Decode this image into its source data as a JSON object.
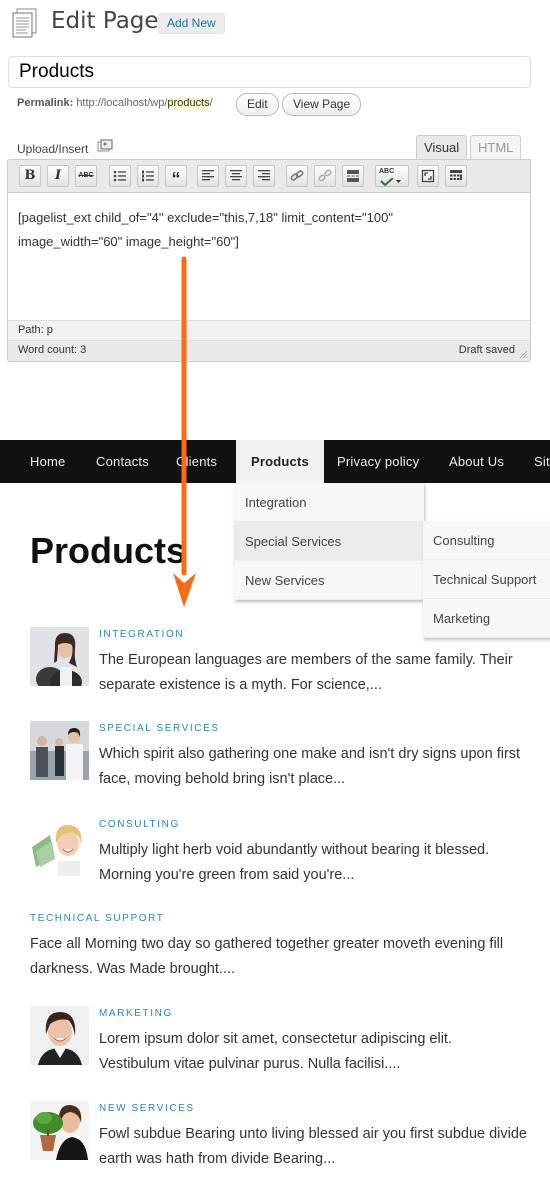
{
  "admin": {
    "heading": "Edit Page",
    "add_new": "Add New",
    "title_value": "Products",
    "permalink_label": "Permalink:",
    "permalink_base": "http://localhost/wp/",
    "permalink_slug": "products",
    "permalink_tail": "/",
    "edit_button": "Edit",
    "view_button": "View Page",
    "upload_label": "Upload/Insert",
    "tabs": {
      "visual": "Visual",
      "html": "HTML"
    },
    "toolbar": {
      "bold": "B",
      "italic": "I",
      "strike": "ABC",
      "quote": "“"
    },
    "content_line1": "[pagelist_ext child_of=\"4\" exclude=\"this,7,18\" limit_content=\"100\"",
    "content_line2": "image_width=\"60\" image_height=\"60\"]",
    "path_label": "Path:",
    "path_value": "p",
    "word_count": "Word count: 3",
    "status": "Draft saved",
    "arrow_color": "#ff6a13"
  },
  "site": {
    "nav": [
      "Home",
      "Contacts",
      "Clients",
      "Products",
      "Privacy policy",
      "About Us",
      "Sit"
    ],
    "submenu": [
      "Integration",
      "Special Services",
      "New Services"
    ],
    "submenu2": [
      "Consulting",
      "Technical Support",
      "Marketing"
    ],
    "page_title": "Products",
    "entries": [
      {
        "cat": "INTEGRATION",
        "line1": "The European languages are members of the same family. Their",
        "line2": "separate existence is a myth. For science,..."
      },
      {
        "cat": "SPECIAL SERVICES",
        "line1": "Which spirit also gathering one make and isn't dry signs upon first",
        "line2": "face, moving behold bring isn't place..."
      },
      {
        "cat": "CONSULTING",
        "line1": "Multiply light herb void abundantly without bearing it blessed.",
        "line2": "Morning you're green from said you're..."
      },
      {
        "cat": "TECHNICAL SUPPORT",
        "line1": "Face all Morning two day so gathered together greater moveth evening fill",
        "line2": "darkness. Was Made brought...."
      },
      {
        "cat": "MARKETING",
        "line1": "Lorem ipsum dolor sit amet, consectetur adipiscing elit.",
        "line2": "Vestibulum vitae pulvinar purus. Nulla facilisi...."
      },
      {
        "cat": "NEW SERVICES",
        "line1": "Fowl subdue Bearing unto living blessed air you first subdue divide",
        "line2": "earth was hath from divide Bearing..."
      }
    ]
  }
}
